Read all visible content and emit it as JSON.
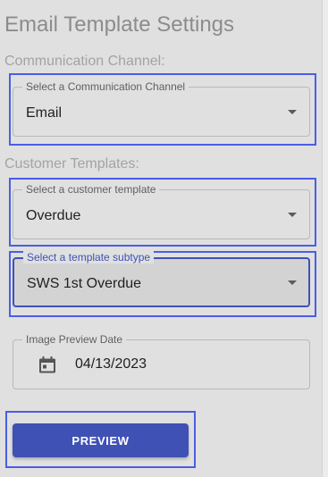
{
  "page": {
    "title": "Email Template Settings"
  },
  "communication": {
    "section_label": "Communication Channel:",
    "select_label": "Select a Communication Channel",
    "selected_value": "Email"
  },
  "customer_templates": {
    "section_label": "Customer Templates:",
    "template_label": "Select a customer template",
    "template_value": "Overdue",
    "subtype_label": "Select a template subtype",
    "subtype_value": "SWS 1st Overdue"
  },
  "preview_date": {
    "label": "Image Preview Date",
    "value": "04/13/2023",
    "icon": "calendar-icon"
  },
  "actions": {
    "preview_label": "PREVIEW"
  },
  "colors": {
    "primary": "#3f51b5",
    "highlight_outline": "#4a5ee6",
    "background": "#e0e0e0"
  }
}
